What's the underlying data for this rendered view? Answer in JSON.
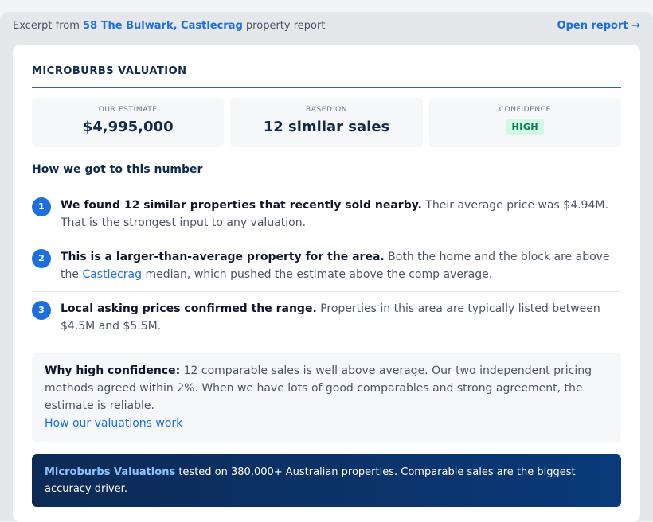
{
  "topbar": {
    "excerpt_prefix": "Excerpt from ",
    "property_link": "58 The Bulwark, Castlecrag",
    "excerpt_suffix": " property report",
    "open_report": "Open report →"
  },
  "valuation": {
    "title": "MICROBURBS VALUATION",
    "stats": [
      {
        "label": "OUR ESTIMATE",
        "value": "$4,995,000"
      },
      {
        "label": "BASED ON",
        "value": "12 similar sales"
      },
      {
        "label": "CONFIDENCE",
        "badge": "HIGH"
      }
    ],
    "how_title": "How we got to this number",
    "steps": [
      {
        "num": "1",
        "bold": "We found 12 similar properties that recently sold nearby.",
        "text": " Their average price was $4.94M. That is the strongest input to any valuation."
      },
      {
        "num": "2",
        "bold": "This is a larger-than-average property for the area.",
        "text_before": " Both the home and the block are above the ",
        "link": "Castlecrag",
        "text_after": " median, which pushed the estimate above the comp average."
      },
      {
        "num": "3",
        "bold": "Local asking prices confirmed the range.",
        "text": " Properties in this area are typically listed between $4.5M and $5.5M."
      }
    ],
    "confidence": {
      "bold": "Why high confidence:",
      "text": " 12 comparable sales is well above average. Our two independent pricing methods agreed within 2%. When we have lots of good comparables and strong agreement, the estimate is reliable.",
      "link": "How our valuations work"
    },
    "footer": {
      "brand": "Microburbs Valuations",
      "text": " tested on 380,000+ Australian properties. Comparable sales are the biggest accuracy driver."
    }
  }
}
